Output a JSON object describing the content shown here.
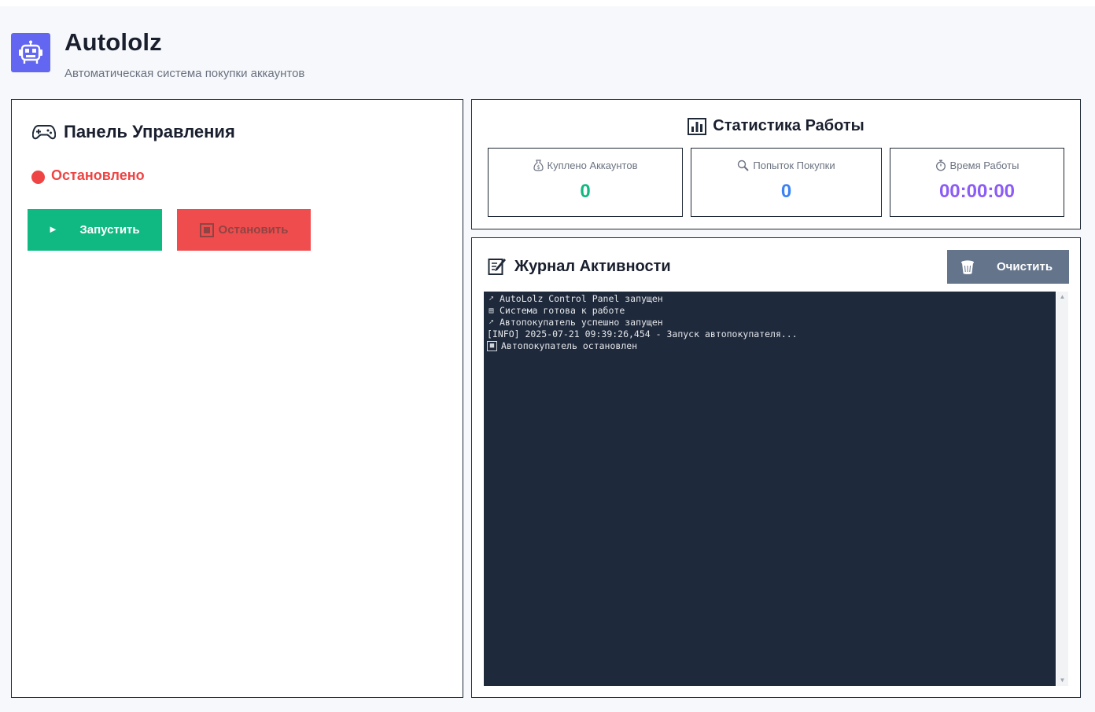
{
  "header": {
    "logo_icon": "robot-icon",
    "title": "Autololz",
    "subtitle": "Автоматическая система покупки аккаунтов",
    "accent_color": "#6366f1"
  },
  "control_panel": {
    "icon": "gamepad-icon",
    "title": "Панель Управления",
    "status": {
      "text": "Остановлено",
      "color": "#ef4444"
    },
    "start_button": {
      "icon": "play-icon",
      "label": "Запустить",
      "color": "#10b981"
    },
    "stop_button": {
      "icon": "stop-icon",
      "label": "Остановить",
      "color": "#ef4444"
    }
  },
  "stats_panel": {
    "icon": "bar-chart-icon",
    "title": "Статистика Работы",
    "cards": [
      {
        "icon": "money-bag-icon",
        "label": "Куплено Аккаунтов",
        "value": "0",
        "color": "#10b981"
      },
      {
        "icon": "magnifier-icon",
        "label": "Попыток Покупки",
        "value": "0",
        "color": "#3b82f6"
      },
      {
        "icon": "stopwatch-icon",
        "label": "Время Работы",
        "value": "00:00:00",
        "color": "#8b5cf6"
      }
    ]
  },
  "log_panel": {
    "icon": "memo-icon",
    "title": "Журнал Активности",
    "clear_button": {
      "icon": "trash-icon",
      "label": "Очистить"
    },
    "lines": [
      {
        "icon": "rocket-icon",
        "text": "AutoLolz Control Panel запущен"
      },
      {
        "icon": "document-icon",
        "text": "Система готова к работе"
      },
      {
        "icon": "rocket-icon",
        "text": "Автопокупатель успешно запущен"
      },
      {
        "icon": "",
        "text": "[INFO] 2025-07-21 09:39:26,454 - Запуск автопокупателя..."
      },
      {
        "icon": "stop-icon",
        "text": "Автопокупатель остановлен"
      }
    ]
  }
}
